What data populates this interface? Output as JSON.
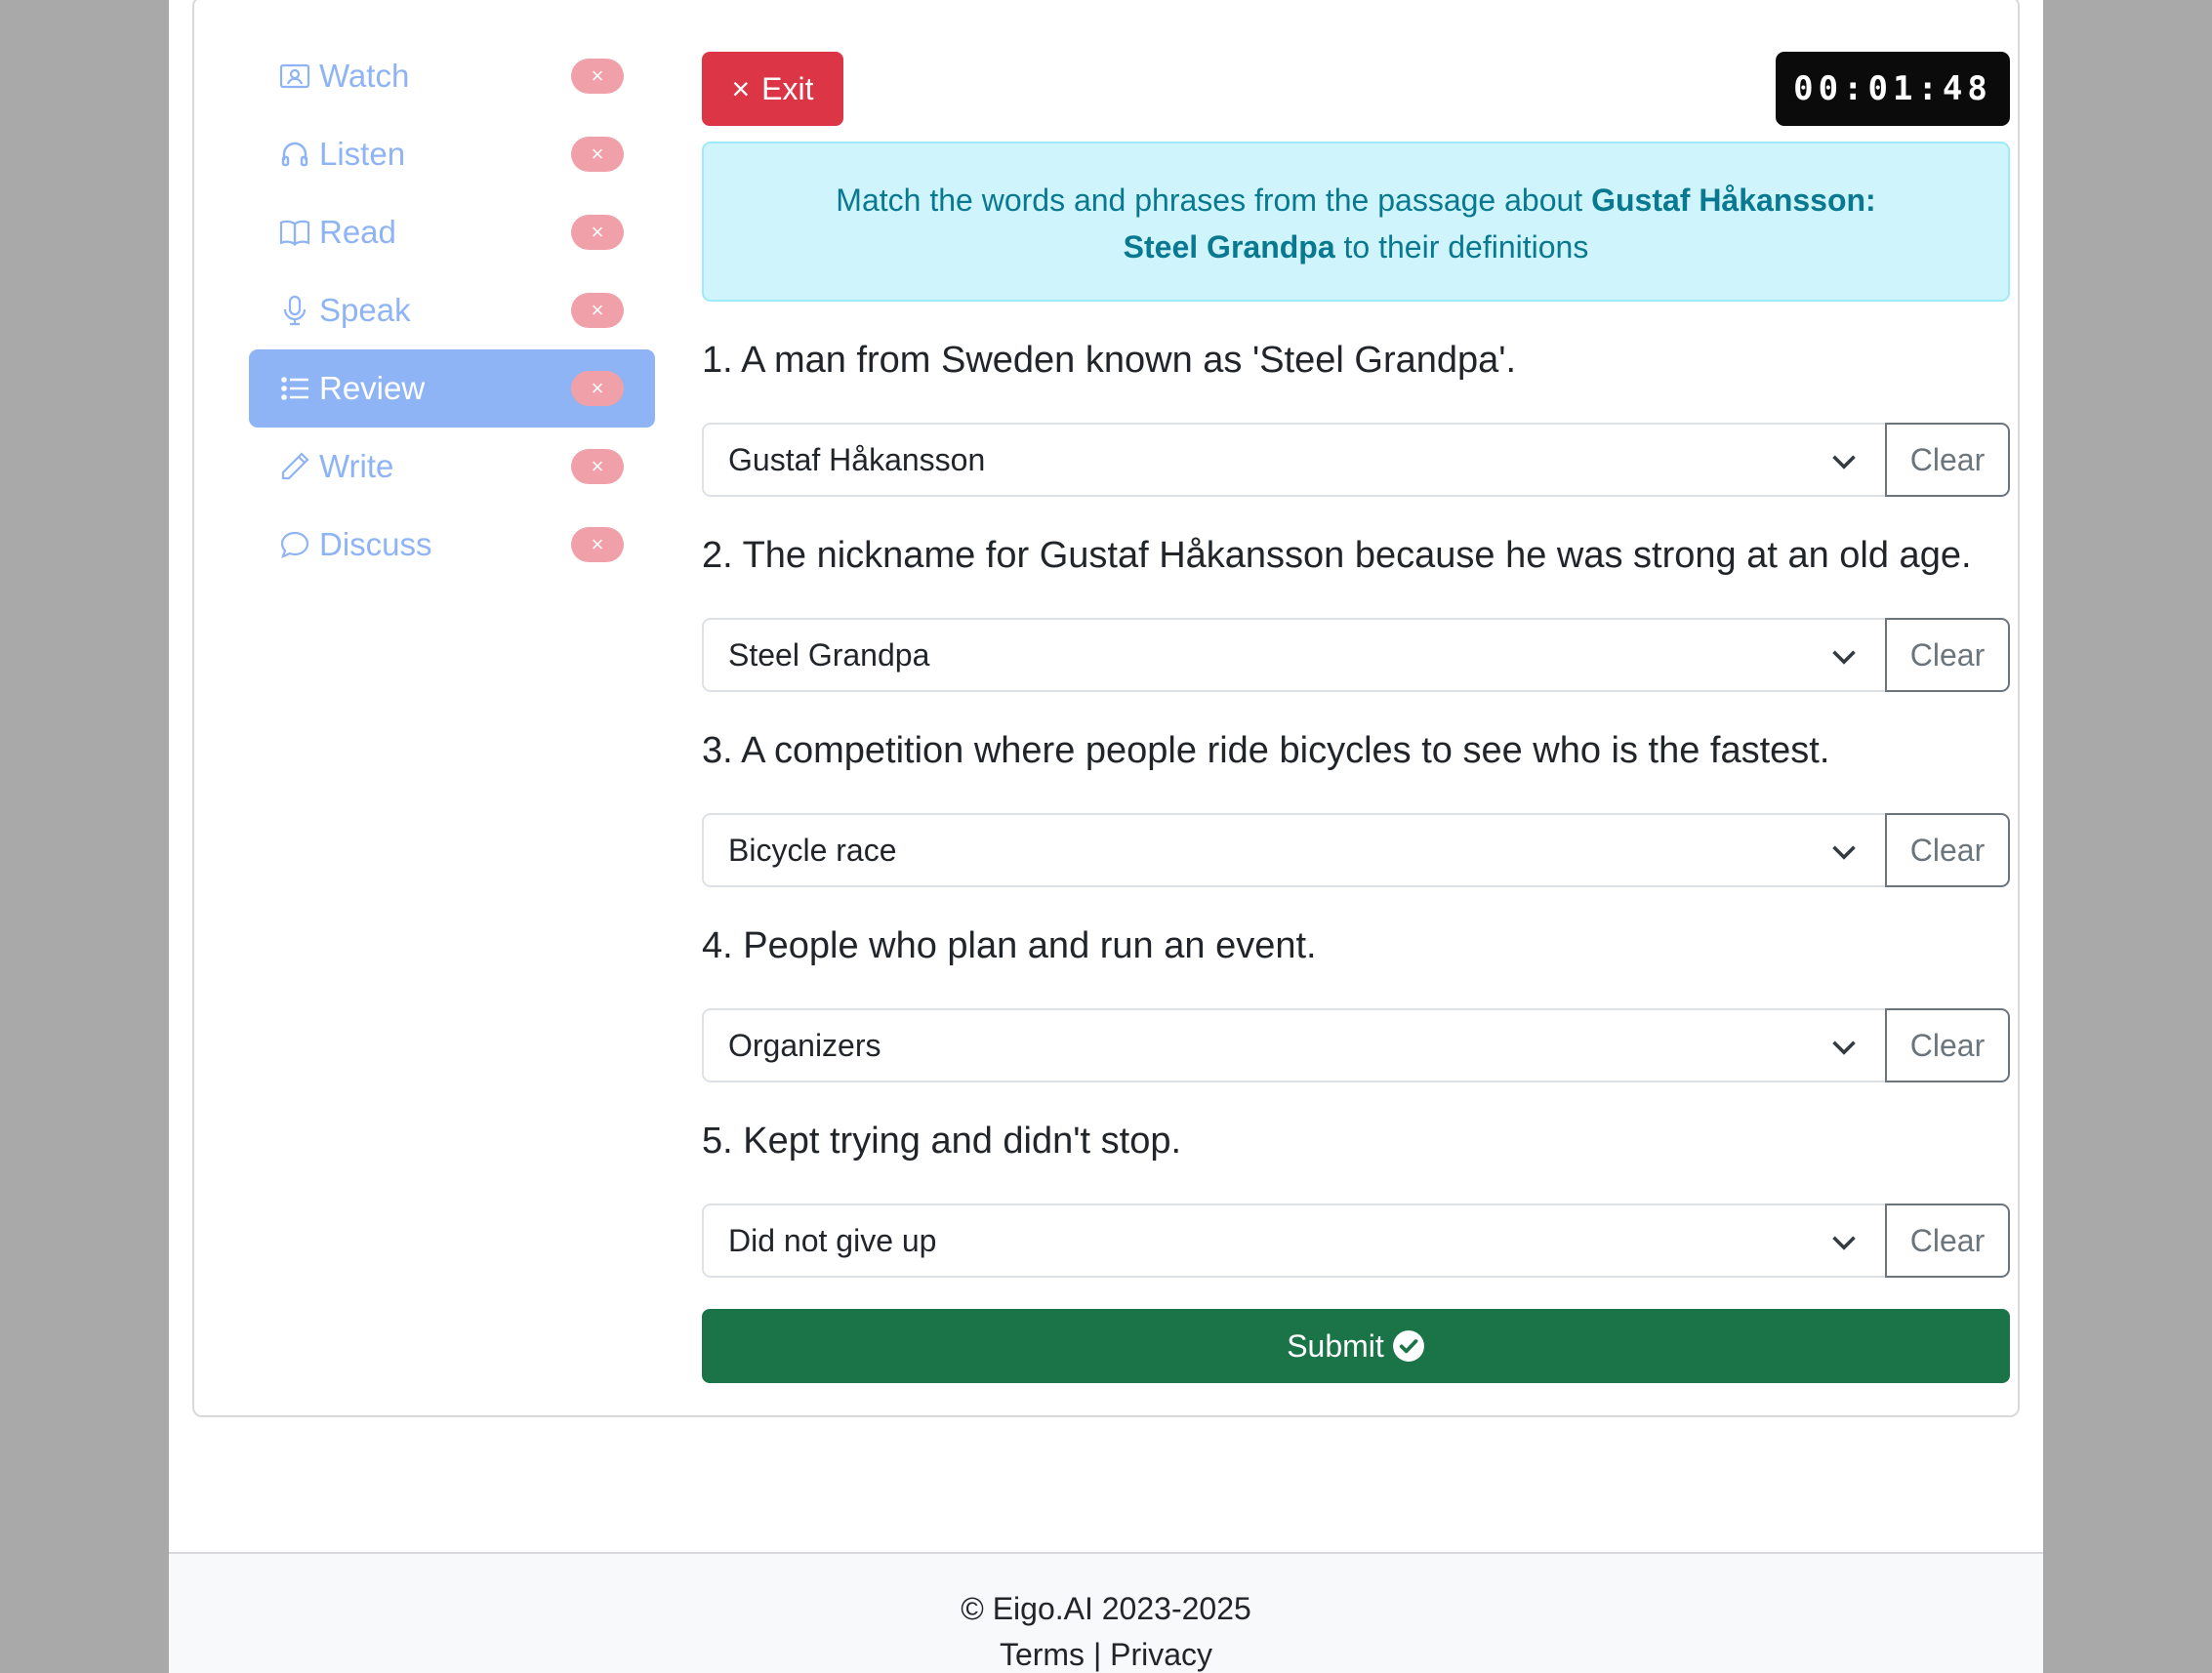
{
  "sidebar": {
    "items": [
      {
        "label": "Watch",
        "icon": "person-video-icon",
        "active": false,
        "badge": "×"
      },
      {
        "label": "Listen",
        "icon": "headphones-icon",
        "active": false,
        "badge": "×"
      },
      {
        "label": "Read",
        "icon": "book-icon",
        "active": false,
        "badge": "×"
      },
      {
        "label": "Speak",
        "icon": "mic-icon",
        "active": false,
        "badge": "×"
      },
      {
        "label": "Review",
        "icon": "list-icon",
        "active": true,
        "badge": "×"
      },
      {
        "label": "Write",
        "icon": "pencil-icon",
        "active": false,
        "badge": "×"
      },
      {
        "label": "Discuss",
        "icon": "chat-icon",
        "active": false,
        "badge": "×"
      }
    ]
  },
  "toolbar": {
    "exit_label": "Exit",
    "exit_icon": "×",
    "timer": "00:01:48"
  },
  "instructions": {
    "prefix": "Match the words and phrases from the passage about ",
    "topic": "Gustaf Håkansson: Steel Grandpa",
    "suffix": " to their definitions"
  },
  "questions": [
    {
      "text": "1. A man from Sweden known as 'Steel Grandpa'.",
      "answer": "Gustaf Håkansson",
      "clear_label": "Clear"
    },
    {
      "text": "2. The nickname for Gustaf Håkansson because he was strong at an old age.",
      "answer": "Steel Grandpa",
      "clear_label": "Clear"
    },
    {
      "text": "3. A competition where people ride bicycles to see who is the fastest.",
      "answer": "Bicycle race",
      "clear_label": "Clear"
    },
    {
      "text": "4. People who plan and run an event.",
      "answer": "Organizers",
      "clear_label": "Clear"
    },
    {
      "text": "5. Kept trying and didn't stop.",
      "answer": "Did not give up",
      "clear_label": "Clear"
    }
  ],
  "submit_label": "Submit",
  "footer": {
    "copyright": "© Eigo.AI 2023-2025",
    "terms": "Terms",
    "separator": " | ",
    "privacy": "Privacy"
  },
  "colors": {
    "nav_accent": "#8fb4f6",
    "badge": "#f0a0a8",
    "exit": "#dc3545",
    "submit": "#1b7448",
    "info_bg": "#cff4fc",
    "info_text": "#087990"
  }
}
